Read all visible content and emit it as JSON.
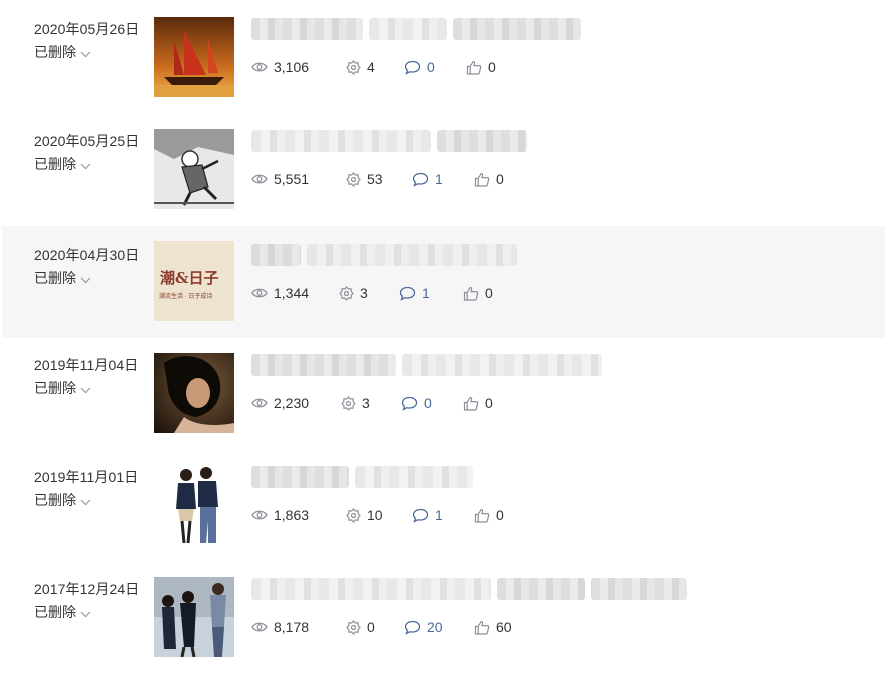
{
  "rows": [
    {
      "date": "2020年05月26日",
      "status": "已删除",
      "views": "3,106",
      "shares": "4",
      "comments": "0",
      "likes": "0",
      "highlighted": false
    },
    {
      "date": "2020年05月25日",
      "status": "已删除",
      "views": "5,551",
      "shares": "53",
      "comments": "1",
      "likes": "0",
      "highlighted": false
    },
    {
      "date": "2020年04月30日",
      "status": "已删除",
      "views": "1,344",
      "shares": "3",
      "comments": "1",
      "likes": "0",
      "highlighted": true,
      "thumb_text": "潮&日子",
      "thumb_sub": "潮流生活 · 日子成诗"
    },
    {
      "date": "2019年11月04日",
      "status": "已删除",
      "views": "2,230",
      "shares": "3",
      "comments": "0",
      "likes": "0",
      "highlighted": false
    },
    {
      "date": "2019年11月01日",
      "status": "已删除",
      "views": "1,863",
      "shares": "10",
      "comments": "1",
      "likes": "0",
      "highlighted": false
    },
    {
      "date": "2017年12月24日",
      "status": "已删除",
      "views": "8,178",
      "shares": "0",
      "comments": "20",
      "likes": "60",
      "highlighted": false
    }
  ],
  "icons": {
    "views": "eye-icon",
    "shares": "share-gear-icon",
    "comments": "comment-bubble-icon",
    "likes": "thumbs-up-icon",
    "status": "chevron-down-icon"
  },
  "colors": {
    "icon": "#8a8f99",
    "comment_count": "#4a6a9a",
    "highlight_bg": "#f6f6f6"
  }
}
